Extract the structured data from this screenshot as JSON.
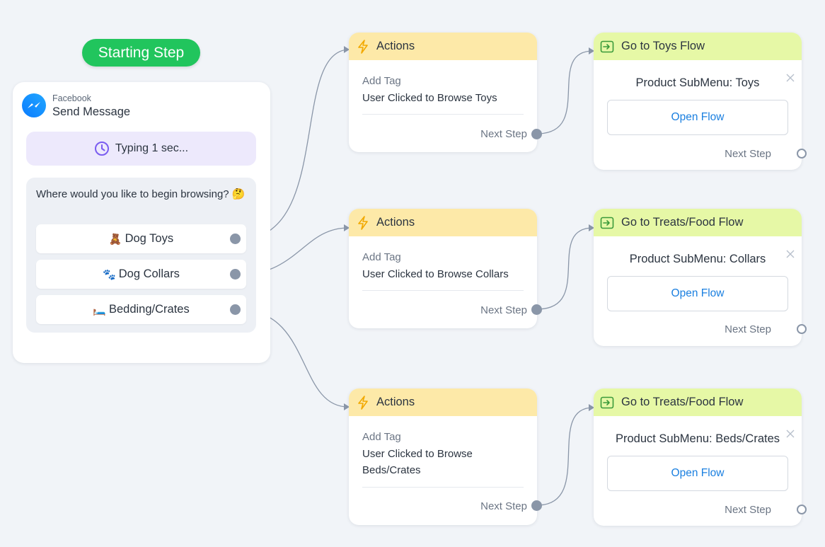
{
  "start": {
    "label": "Starting Step"
  },
  "send_message": {
    "channel": "Facebook",
    "title": "Send Message",
    "typing": "Typing 1 sec...",
    "message_text": "Where would you like to begin browsing? 🤔",
    "quick_replies": [
      {
        "emoji": "🧸",
        "label": "Dog Toys"
      },
      {
        "emoji": "🐾",
        "label": "Dog Collars"
      },
      {
        "emoji": "🛏️",
        "label": "Bedding/Crates"
      }
    ]
  },
  "actions": [
    {
      "header": "Actions",
      "label": "Add Tag",
      "value": "User Clicked to Browse Toys",
      "next_step": "Next Step"
    },
    {
      "header": "Actions",
      "label": "Add Tag",
      "value": "User Clicked to Browse Collars",
      "next_step": "Next Step"
    },
    {
      "header": "Actions",
      "label": "Add Tag",
      "value": "User Clicked to Browse Beds/Crates",
      "next_step": "Next Step"
    }
  ],
  "flows": [
    {
      "header": "Go to Toys Flow",
      "subtitle": "Product SubMenu: Toys",
      "button": "Open Flow",
      "next_step": "Next Step"
    },
    {
      "header": "Go to Treats/Food Flow",
      "subtitle": "Product SubMenu: Collars",
      "button": "Open Flow",
      "next_step": "Next Step"
    },
    {
      "header": "Go to Treats/Food Flow",
      "subtitle": "Product SubMenu: Beds/Crates",
      "button": "Open Flow",
      "next_step": "Next Step"
    }
  ],
  "colors": {
    "start_green": "#21c55d",
    "action_header": "#fde9a8",
    "flow_header": "#e6f8a6",
    "typing_bg": "#ede9fc",
    "link_blue": "#1a7fe0",
    "connector": "#8a96a8"
  },
  "icons": {
    "messenger": "messenger-icon",
    "clock": "clock-icon",
    "bolt": "lightning-bolt-icon",
    "go_to_flow": "go-to-flow-icon",
    "close": "close-icon"
  }
}
